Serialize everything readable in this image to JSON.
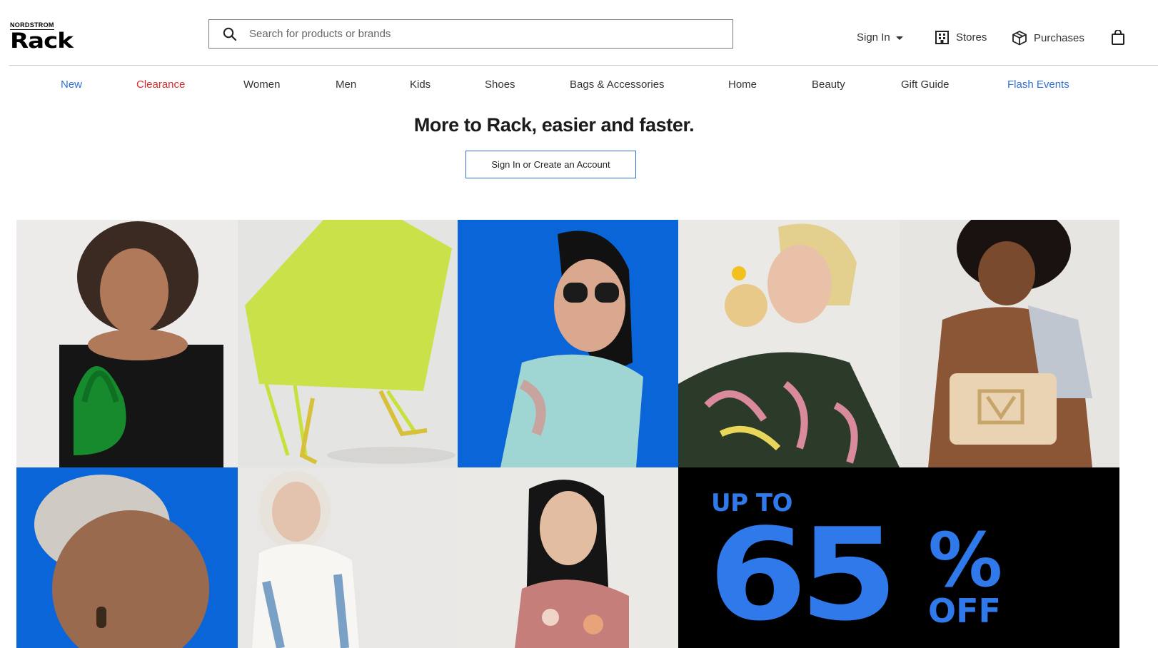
{
  "header": {
    "logo": {
      "top": "NORDSTROM",
      "main": "Rack"
    },
    "search": {
      "placeholder": "Search for products or brands"
    },
    "sign_in": "Sign In",
    "stores": "Stores",
    "purchases": "Purchases"
  },
  "nav": {
    "items": [
      "New",
      "Clearance",
      "Women",
      "Men",
      "Kids",
      "Shoes",
      "Bags & Accessories",
      "Home",
      "Beauty",
      "Gift Guide",
      "Flash Events"
    ]
  },
  "promo": {
    "headline": "More to Rack, easier and faster.",
    "cta": "Sign In or Create an Account"
  },
  "sale_banner": {
    "up_to": "UP TO",
    "percent": "65",
    "symbol": "%",
    "off": "OFF"
  },
  "colors": {
    "accent_blue": "#2f6fd6",
    "clearance_red": "#d72b2b",
    "tile_blue": "#0a66d8",
    "sale_blue": "#2f79ea"
  }
}
